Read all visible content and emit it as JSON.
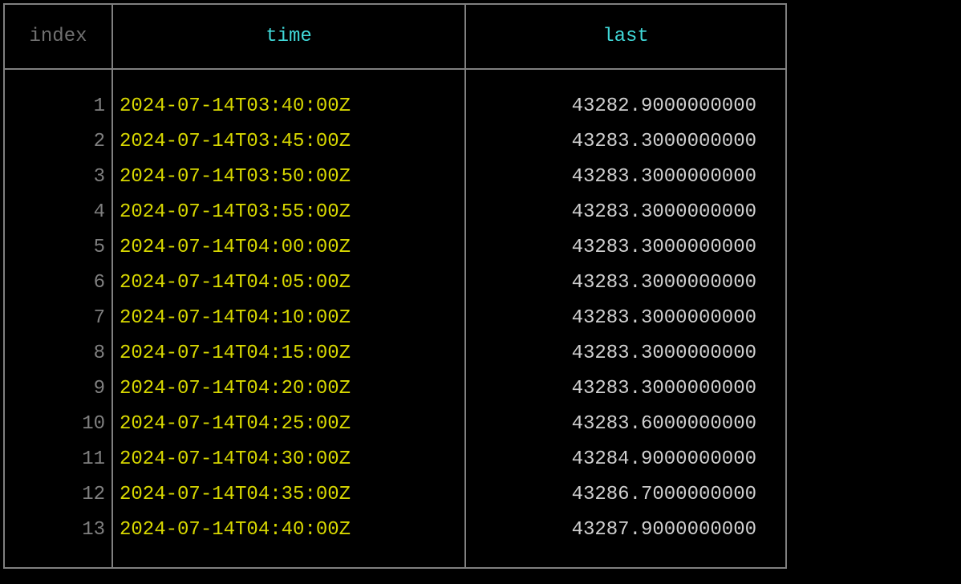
{
  "headers": {
    "index": "index",
    "time": "time",
    "last": "last"
  },
  "rows": [
    {
      "index": "1",
      "time": "2024-07-14T03:40:00Z",
      "last": "43282.9000000000"
    },
    {
      "index": "2",
      "time": "2024-07-14T03:45:00Z",
      "last": "43283.3000000000"
    },
    {
      "index": "3",
      "time": "2024-07-14T03:50:00Z",
      "last": "43283.3000000000"
    },
    {
      "index": "4",
      "time": "2024-07-14T03:55:00Z",
      "last": "43283.3000000000"
    },
    {
      "index": "5",
      "time": "2024-07-14T04:00:00Z",
      "last": "43283.3000000000"
    },
    {
      "index": "6",
      "time": "2024-07-14T04:05:00Z",
      "last": "43283.3000000000"
    },
    {
      "index": "7",
      "time": "2024-07-14T04:10:00Z",
      "last": "43283.3000000000"
    },
    {
      "index": "8",
      "time": "2024-07-14T04:15:00Z",
      "last": "43283.3000000000"
    },
    {
      "index": "9",
      "time": "2024-07-14T04:20:00Z",
      "last": "43283.3000000000"
    },
    {
      "index": "10",
      "time": "2024-07-14T04:25:00Z",
      "last": "43283.6000000000"
    },
    {
      "index": "11",
      "time": "2024-07-14T04:30:00Z",
      "last": "43284.9000000000"
    },
    {
      "index": "12",
      "time": "2024-07-14T04:35:00Z",
      "last": "43286.7000000000"
    },
    {
      "index": "13",
      "time": "2024-07-14T04:40:00Z",
      "last": "43287.9000000000"
    }
  ]
}
